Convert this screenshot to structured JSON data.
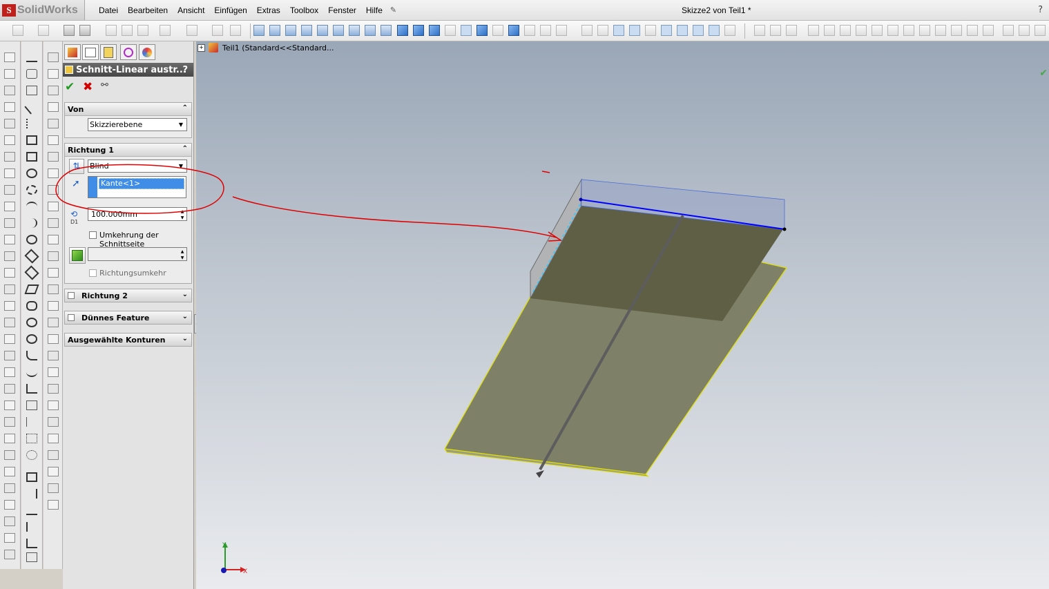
{
  "app": {
    "name": "SolidWorks",
    "document_title": "Skizze2 von Teil1 *",
    "help": "?"
  },
  "menu": [
    "Datei",
    "Bearbeiten",
    "Ansicht",
    "Einfügen",
    "Extras",
    "Toolbox",
    "Fenster",
    "Hilfe"
  ],
  "tree": {
    "root_label": "Teil1  (Standard<<Standard..."
  },
  "property_manager": {
    "title": "Schnitt-Linear austr...",
    "help": "?",
    "von": {
      "label": "Von",
      "start_condition": "Skizzierebene"
    },
    "richtung1": {
      "label": "Richtung 1",
      "end_condition": "Blind",
      "direction_selection": "Kante<1>",
      "depth_label": "D1",
      "depth_value": "100.000mm",
      "flip_side_label": "Umkehrung der Schnittseite",
      "flip_side_checked": false,
      "draft_value": "",
      "reverse_direction_label": "Richtungsumkehr",
      "reverse_direction_checked": false
    },
    "collapsed_groups": [
      "Richtung 2",
      "Dünnes Feature",
      "Ausgewählte Konturen"
    ]
  },
  "viewport": {
    "axis_labels": {
      "y": "Y",
      "x": "X"
    },
    "annotation_color": "#e00000",
    "selection_color": "#0000ff",
    "highlight_color": "#ffff00"
  },
  "colors": {
    "face_light": "#7e8068",
    "face_dark": "#5e5e45",
    "pm_header": "#555555",
    "ok": "#1f9a1f",
    "cancel": "#d10000"
  }
}
